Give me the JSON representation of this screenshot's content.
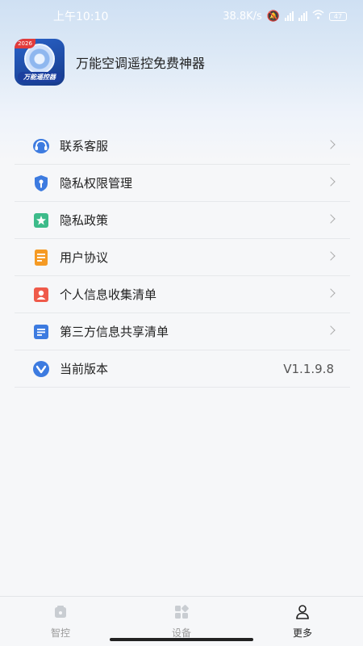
{
  "status": {
    "time": "上午10:10",
    "speed": "38.8K/s",
    "battery": "47"
  },
  "app": {
    "name": "万能空调遥控免费神器",
    "logo_badge": "2026",
    "logo_ribbon": "万能遥控器"
  },
  "menu": {
    "items": [
      {
        "label": "联系客服",
        "icon": "headset-icon"
      },
      {
        "label": "隐私权限管理",
        "icon": "shield-key-icon"
      },
      {
        "label": "隐私政策",
        "icon": "star-card-icon"
      },
      {
        "label": "用户协议",
        "icon": "document-icon"
      },
      {
        "label": "个人信息收集清单",
        "icon": "person-card-icon"
      },
      {
        "label": "第三方信息共享清单",
        "icon": "list-card-icon"
      },
      {
        "label": "当前版本",
        "icon": "check-v-icon"
      }
    ],
    "version": "V1.1.9.8"
  },
  "nav": {
    "items": [
      {
        "label": "智控",
        "icon": "remote-icon"
      },
      {
        "label": "设备",
        "icon": "grid-icon"
      },
      {
        "label": "更多",
        "icon": "person-icon"
      }
    ],
    "active": "更多"
  },
  "colors": {
    "accent_blue": "#3d7be0",
    "orange": "#f59a23",
    "red": "#ef5a4a",
    "green": "#3dbb8a"
  }
}
